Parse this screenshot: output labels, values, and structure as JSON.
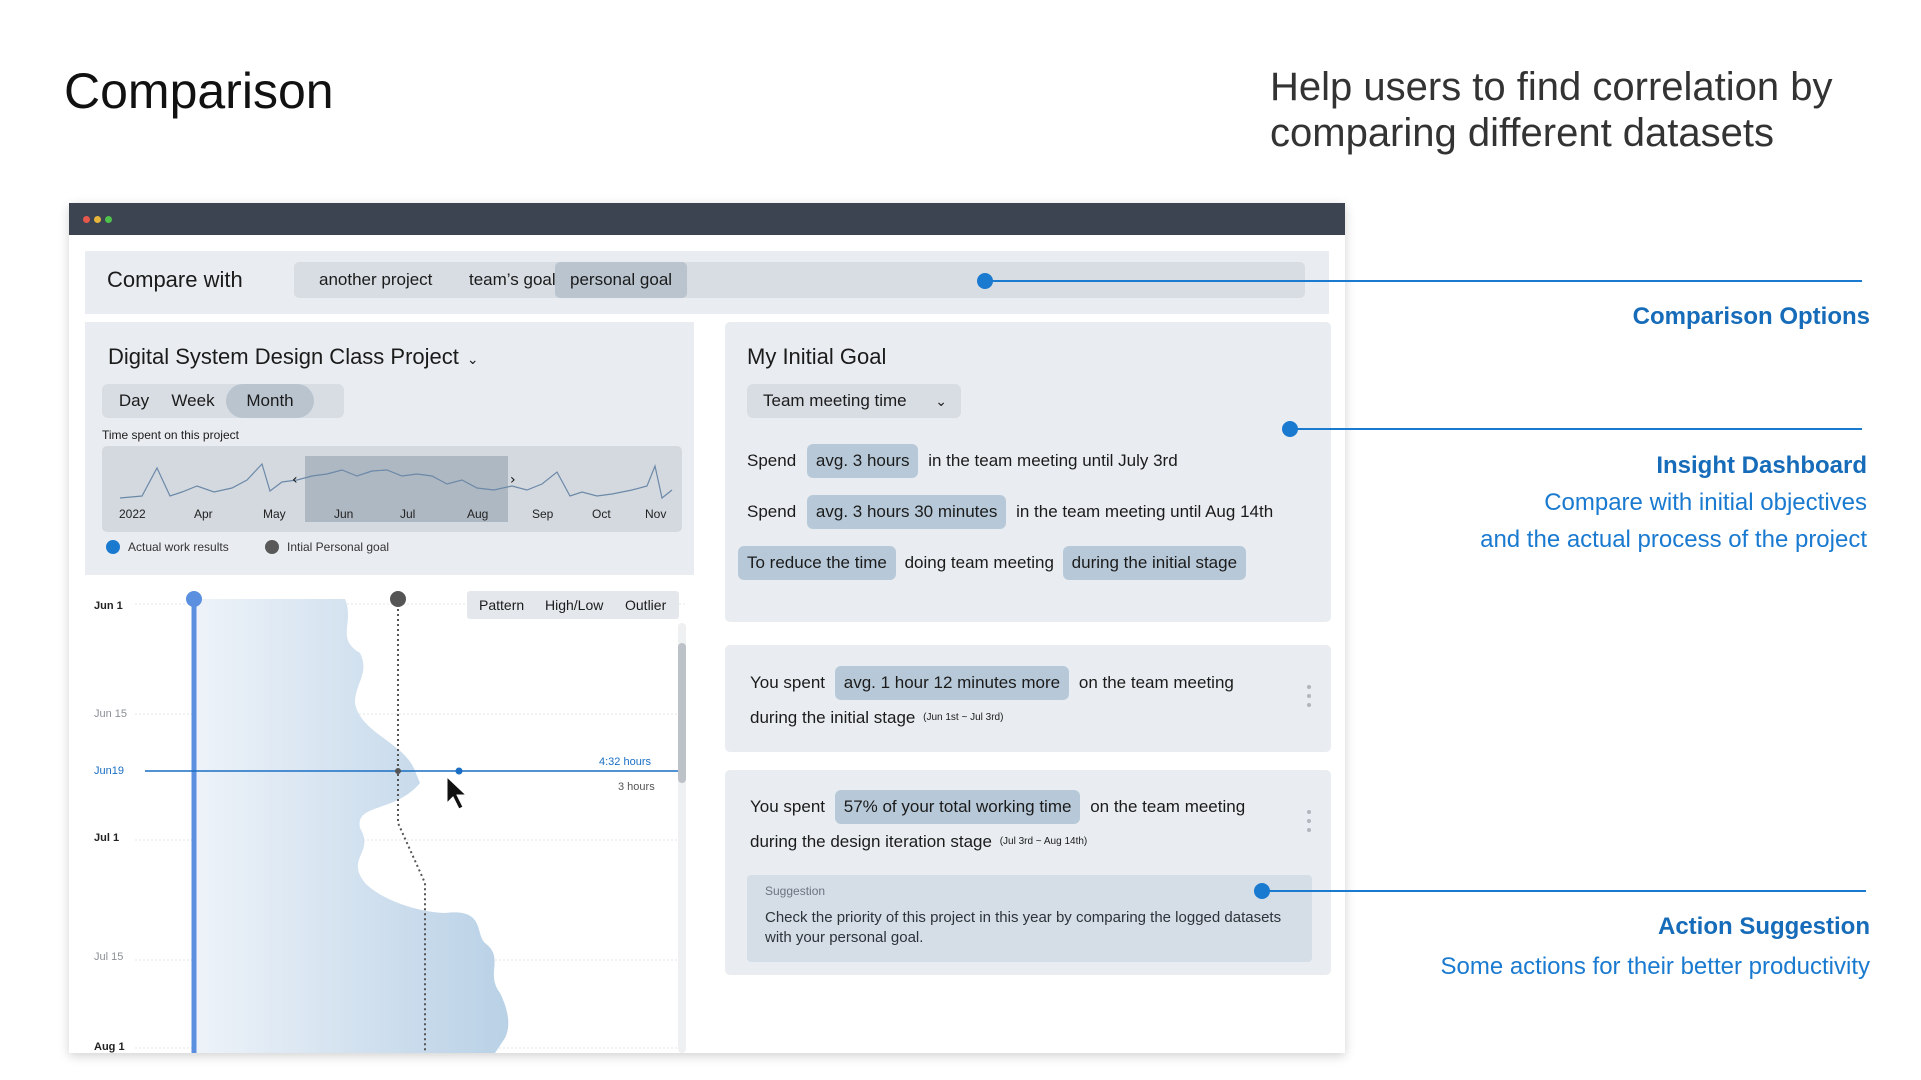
{
  "page": {
    "title": "Comparison",
    "subtitle_line1": "Help users to find correlation by",
    "subtitle_line2": "comparing different datasets"
  },
  "compare": {
    "label": "Compare with",
    "tabs": [
      "another project",
      "team’s goal",
      "personal goal"
    ],
    "active_tab": "personal goal"
  },
  "project": {
    "title": "Digital System Design Class Project",
    "range_tabs": [
      "Day",
      "Week",
      "Month"
    ],
    "active_range": "Month",
    "overview_label": "Time spent on this project",
    "overview_months": [
      "2022",
      "Apr",
      "May",
      "Jun",
      "Jul",
      "Aug",
      "Sep",
      "Oct",
      "Nov"
    ],
    "legend": [
      "Actual work results",
      "Intial Personal goal"
    ]
  },
  "chart": {
    "tabs": [
      "Pattern",
      "High/Low",
      "Outlier"
    ],
    "date_labels": [
      "Jun 1",
      "Jun 15",
      "Jun19",
      "Jul 1",
      "Jul 15",
      "Aug 1"
    ],
    "hover_actual": "4:32 hours",
    "hover_goal": "3 hours"
  },
  "chart_data": {
    "type": "area",
    "title": "",
    "orientation": "vertical-time",
    "series": [
      {
        "name": "Actual work results",
        "note": "daily hours (area)"
      },
      {
        "name": "Intial Personal goal",
        "note": "daily hours (dotted line)"
      }
    ],
    "annotations": [
      {
        "date": "Jun19",
        "Actual work results": "4:32 hours",
        "Intial Personal goal": "3 hours"
      }
    ]
  },
  "goal": {
    "title": "My Initial Goal",
    "select": "Team meeting time",
    "row1": {
      "pre": "Spend",
      "pill": "avg. 3 hours",
      "post": "in the team meeting until July 3rd"
    },
    "row2": {
      "pre": "Spend",
      "pill": "avg. 3 hours 30 minutes",
      "post": "in the team meeting until Aug 14th"
    },
    "row3": {
      "pill1": "To reduce the time",
      "mid": "doing team meeting",
      "pill2": "during the initial stage"
    }
  },
  "insight1": {
    "pre": "You spent",
    "pill": "avg. 1 hour 12 minutes more",
    "post": "on the team meeting",
    "line2": "during the initial stage",
    "range": "(Jun 1st ~ Jul 3rd)"
  },
  "insight2": {
    "pre": "You spent",
    "pill": "57% of your total working time",
    "post": "on the team meeting",
    "line2": "during the design iteration stage",
    "range": "(Jul 3rd ~ Aug 14th)"
  },
  "suggestion": {
    "label": "Suggestion",
    "text": "Check the priority of this project in this year by comparing the logged datasets with your personal goal."
  },
  "annotations": {
    "comparison_title": "Comparison Options",
    "insight_title": "Insight Dashboard",
    "insight_desc1": "Compare with initial objectives",
    "insight_desc2": "and the actual process of the project",
    "action_title": "Action Suggestion",
    "action_desc": "Some actions for their better productivity"
  },
  "colors": {
    "accent": "#1a7ad0",
    "actual": "#5b8fe0",
    "goal": "#555555",
    "pill": "#b7c9d8",
    "panel": "#e9edf1",
    "titlebar": "#3c4451"
  }
}
